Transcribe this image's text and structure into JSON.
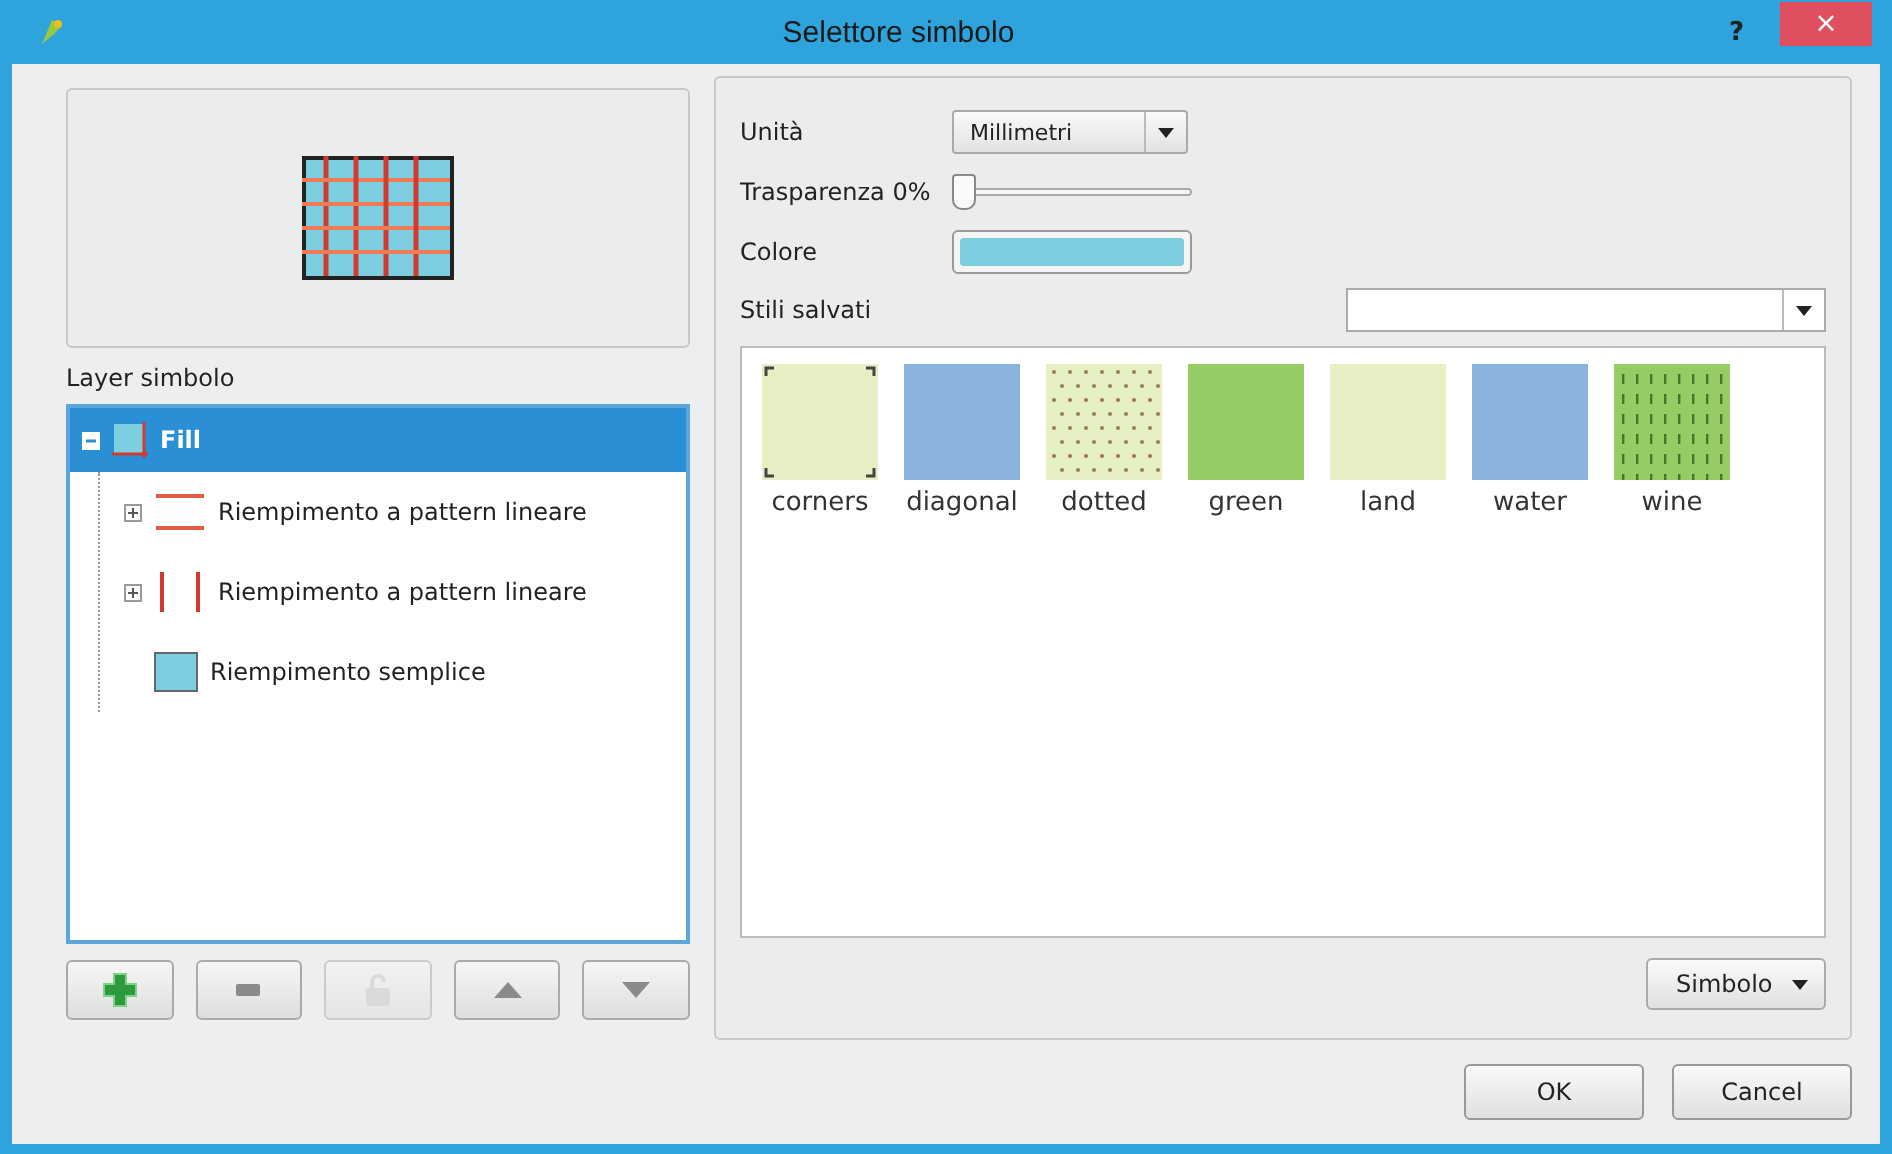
{
  "window": {
    "title": "Selettore simbolo",
    "help": "?",
    "close": "×"
  },
  "preview": {
    "kind": "picture"
  },
  "layers_label": "Layer simbolo",
  "tree": [
    {
      "label": "Fill",
      "expanded": true,
      "selected": true,
      "children": [
        {
          "label": "Riempimento a pattern lineare",
          "kind": "line-horizontal",
          "has_children": true,
          "expanded": false,
          "selected": false
        },
        {
          "label": "Riempimento a pattern lineare",
          "kind": "line-vertical",
          "has_children": true,
          "expanded": false,
          "selected": false
        },
        {
          "label": "Riempimento semplice",
          "kind": "fill",
          "has_children": false,
          "selected": false
        }
      ]
    }
  ],
  "layer_buttons": [
    {
      "kind": "add",
      "disabled": false
    },
    {
      "kind": "remove",
      "disabled": false
    },
    {
      "kind": "lock",
      "disabled": true
    },
    {
      "kind": "up",
      "disabled": false
    },
    {
      "kind": "down",
      "disabled": false
    }
  ],
  "unit": {
    "label": "Unità",
    "value": "Millimetri"
  },
  "transparency": {
    "label": "Trasparenza 0%",
    "level": 0
  },
  "color": {
    "label": "Colore",
    "color": "#7ccfe0"
  },
  "saved_styles": {
    "label": "Stili salvati"
  },
  "swatches": [
    {
      "name": "corners",
      "kind": "corners",
      "color": "#e6efc4"
    },
    {
      "name": "diagonal",
      "kind": "plain",
      "color": "#8ab4dd"
    },
    {
      "name": "dotted",
      "kind": "dotted",
      "color": "#e6efc4"
    },
    {
      "name": "green",
      "kind": "plain",
      "color": "#95cc63"
    },
    {
      "name": "land",
      "kind": "plain",
      "color": "#e6efc4"
    },
    {
      "name": "water",
      "kind": "plain",
      "color": "#8ab4dd"
    },
    {
      "name": "wine",
      "kind": "dashes",
      "color": "#95cc63"
    }
  ],
  "symbol_button": "Simbolo",
  "buttons": [
    "OK",
    "Cancel"
  ]
}
